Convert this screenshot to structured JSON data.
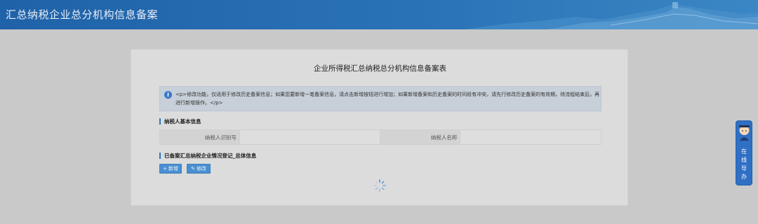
{
  "header": {
    "title": "汇总纳税企业总分机构信息备案"
  },
  "form": {
    "title": "企业所得税汇总纳税总分机构信息备案表",
    "notice": "<p>修改功能，仅适用于修改历史备案信息；如果您要新增一笔备案信息，请点击新增按钮进行增加；如果新增备案和历史备案的时间段有冲突，请先行修改历史备案的有效期，待流程结束后，再进行新增操作。</p>",
    "section_basic": "纳税人基本信息",
    "taxpayer_id_label": "纳税人识别号",
    "taxpayer_id_value": "",
    "taxpayer_name_label": "纳税人名称",
    "taxpayer_name_value": "",
    "section_summary": "已备案汇总纳税企业情况登记_总体信息",
    "add_label": "新增",
    "edit_label": "修改"
  },
  "side_widget": {
    "label_1": "在",
    "label_2": "线",
    "label_3": "导",
    "label_4": "办"
  },
  "colors": {
    "header": "#2a72b6",
    "accent": "#2e73c0",
    "button": "#4a8fd0"
  }
}
